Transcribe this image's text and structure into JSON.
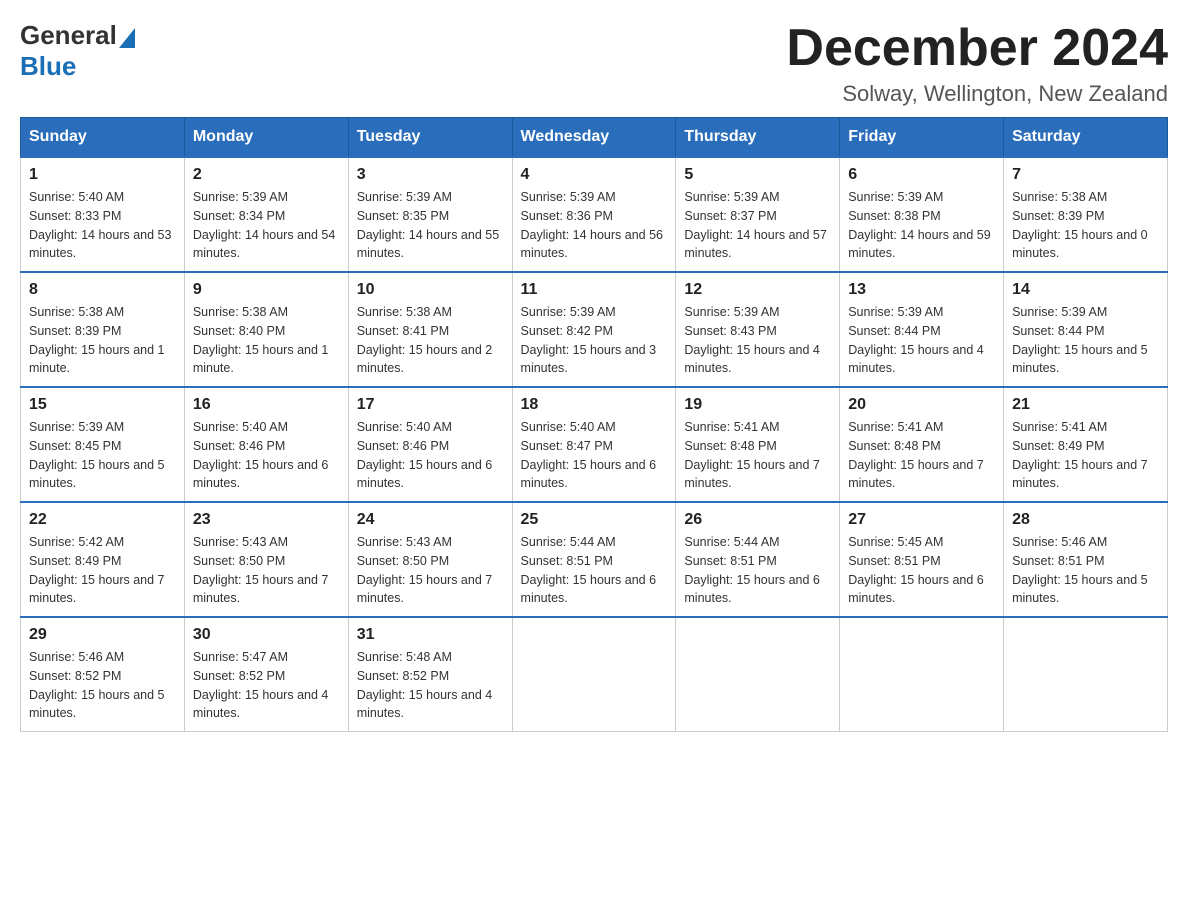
{
  "logo": {
    "text_general": "General",
    "text_blue": "Blue"
  },
  "title": "December 2024",
  "subtitle": "Solway, Wellington, New Zealand",
  "days_of_week": [
    "Sunday",
    "Monday",
    "Tuesday",
    "Wednesday",
    "Thursday",
    "Friday",
    "Saturday"
  ],
  "weeks": [
    [
      {
        "day": "1",
        "sunrise": "5:40 AM",
        "sunset": "8:33 PM",
        "daylight": "14 hours and 53 minutes."
      },
      {
        "day": "2",
        "sunrise": "5:39 AM",
        "sunset": "8:34 PM",
        "daylight": "14 hours and 54 minutes."
      },
      {
        "day": "3",
        "sunrise": "5:39 AM",
        "sunset": "8:35 PM",
        "daylight": "14 hours and 55 minutes."
      },
      {
        "day": "4",
        "sunrise": "5:39 AM",
        "sunset": "8:36 PM",
        "daylight": "14 hours and 56 minutes."
      },
      {
        "day": "5",
        "sunrise": "5:39 AM",
        "sunset": "8:37 PM",
        "daylight": "14 hours and 57 minutes."
      },
      {
        "day": "6",
        "sunrise": "5:39 AM",
        "sunset": "8:38 PM",
        "daylight": "14 hours and 59 minutes."
      },
      {
        "day": "7",
        "sunrise": "5:38 AM",
        "sunset": "8:39 PM",
        "daylight": "15 hours and 0 minutes."
      }
    ],
    [
      {
        "day": "8",
        "sunrise": "5:38 AM",
        "sunset": "8:39 PM",
        "daylight": "15 hours and 1 minute."
      },
      {
        "day": "9",
        "sunrise": "5:38 AM",
        "sunset": "8:40 PM",
        "daylight": "15 hours and 1 minute."
      },
      {
        "day": "10",
        "sunrise": "5:38 AM",
        "sunset": "8:41 PM",
        "daylight": "15 hours and 2 minutes."
      },
      {
        "day": "11",
        "sunrise": "5:39 AM",
        "sunset": "8:42 PM",
        "daylight": "15 hours and 3 minutes."
      },
      {
        "day": "12",
        "sunrise": "5:39 AM",
        "sunset": "8:43 PM",
        "daylight": "15 hours and 4 minutes."
      },
      {
        "day": "13",
        "sunrise": "5:39 AM",
        "sunset": "8:44 PM",
        "daylight": "15 hours and 4 minutes."
      },
      {
        "day": "14",
        "sunrise": "5:39 AM",
        "sunset": "8:44 PM",
        "daylight": "15 hours and 5 minutes."
      }
    ],
    [
      {
        "day": "15",
        "sunrise": "5:39 AM",
        "sunset": "8:45 PM",
        "daylight": "15 hours and 5 minutes."
      },
      {
        "day": "16",
        "sunrise": "5:40 AM",
        "sunset": "8:46 PM",
        "daylight": "15 hours and 6 minutes."
      },
      {
        "day": "17",
        "sunrise": "5:40 AM",
        "sunset": "8:46 PM",
        "daylight": "15 hours and 6 minutes."
      },
      {
        "day": "18",
        "sunrise": "5:40 AM",
        "sunset": "8:47 PM",
        "daylight": "15 hours and 6 minutes."
      },
      {
        "day": "19",
        "sunrise": "5:41 AM",
        "sunset": "8:48 PM",
        "daylight": "15 hours and 7 minutes."
      },
      {
        "day": "20",
        "sunrise": "5:41 AM",
        "sunset": "8:48 PM",
        "daylight": "15 hours and 7 minutes."
      },
      {
        "day": "21",
        "sunrise": "5:41 AM",
        "sunset": "8:49 PM",
        "daylight": "15 hours and 7 minutes."
      }
    ],
    [
      {
        "day": "22",
        "sunrise": "5:42 AM",
        "sunset": "8:49 PM",
        "daylight": "15 hours and 7 minutes."
      },
      {
        "day": "23",
        "sunrise": "5:43 AM",
        "sunset": "8:50 PM",
        "daylight": "15 hours and 7 minutes."
      },
      {
        "day": "24",
        "sunrise": "5:43 AM",
        "sunset": "8:50 PM",
        "daylight": "15 hours and 7 minutes."
      },
      {
        "day": "25",
        "sunrise": "5:44 AM",
        "sunset": "8:51 PM",
        "daylight": "15 hours and 6 minutes."
      },
      {
        "day": "26",
        "sunrise": "5:44 AM",
        "sunset": "8:51 PM",
        "daylight": "15 hours and 6 minutes."
      },
      {
        "day": "27",
        "sunrise": "5:45 AM",
        "sunset": "8:51 PM",
        "daylight": "15 hours and 6 minutes."
      },
      {
        "day": "28",
        "sunrise": "5:46 AM",
        "sunset": "8:51 PM",
        "daylight": "15 hours and 5 minutes."
      }
    ],
    [
      {
        "day": "29",
        "sunrise": "5:46 AM",
        "sunset": "8:52 PM",
        "daylight": "15 hours and 5 minutes."
      },
      {
        "day": "30",
        "sunrise": "5:47 AM",
        "sunset": "8:52 PM",
        "daylight": "15 hours and 4 minutes."
      },
      {
        "day": "31",
        "sunrise": "5:48 AM",
        "sunset": "8:52 PM",
        "daylight": "15 hours and 4 minutes."
      },
      null,
      null,
      null,
      null
    ]
  ]
}
